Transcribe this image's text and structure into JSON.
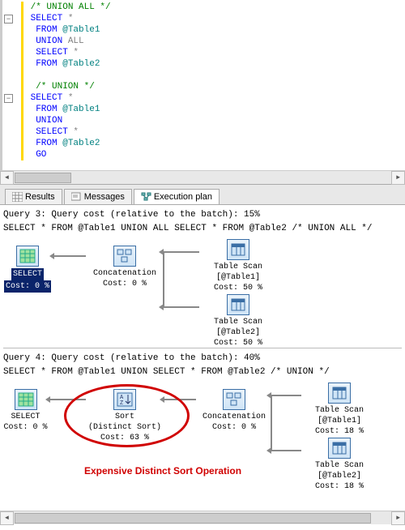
{
  "editor": {
    "lines": [
      {
        "fold": "",
        "yellow": true,
        "tokens": [
          {
            "t": "/* UNION ALL */",
            "c": "cmt"
          }
        ]
      },
      {
        "fold": "-",
        "yellow": true,
        "tokens": [
          {
            "t": "SELECT",
            "c": "kw"
          },
          {
            "t": " "
          },
          {
            "t": "*",
            "c": "star"
          }
        ]
      },
      {
        "fold": "",
        "yellow": true,
        "indent": 1,
        "tokens": [
          {
            "t": "FROM",
            "c": "kw"
          },
          {
            "t": " "
          },
          {
            "t": "@Table1",
            "c": "var"
          }
        ]
      },
      {
        "fold": "",
        "yellow": true,
        "indent": 1,
        "tokens": [
          {
            "t": "UNION",
            "c": "kw"
          },
          {
            "t": " "
          },
          {
            "t": "ALL",
            "c": "kwg"
          }
        ]
      },
      {
        "fold": "",
        "yellow": true,
        "indent": 1,
        "tokens": [
          {
            "t": "SELECT",
            "c": "kw"
          },
          {
            "t": " "
          },
          {
            "t": "*",
            "c": "star"
          }
        ]
      },
      {
        "fold": "",
        "yellow": true,
        "indent": 1,
        "tokens": [
          {
            "t": "FROM",
            "c": "kw"
          },
          {
            "t": " "
          },
          {
            "t": "@Table2",
            "c": "var"
          }
        ]
      },
      {
        "fold": "",
        "yellow": true,
        "tokens": [
          {
            "t": " "
          }
        ]
      },
      {
        "fold": "",
        "yellow": true,
        "indent": 1,
        "tokens": [
          {
            "t": "/* UNION */",
            "c": "cmt"
          }
        ]
      },
      {
        "fold": "-",
        "yellow": true,
        "tokens": [
          {
            "t": "SELECT",
            "c": "kw"
          },
          {
            "t": " "
          },
          {
            "t": "*",
            "c": "star"
          }
        ]
      },
      {
        "fold": "",
        "yellow": true,
        "indent": 1,
        "tokens": [
          {
            "t": "FROM",
            "c": "kw"
          },
          {
            "t": " "
          },
          {
            "t": "@Table1",
            "c": "var"
          }
        ]
      },
      {
        "fold": "",
        "yellow": true,
        "indent": 1,
        "tokens": [
          {
            "t": "UNION",
            "c": "kw"
          }
        ]
      },
      {
        "fold": "",
        "yellow": true,
        "indent": 1,
        "tokens": [
          {
            "t": "SELECT",
            "c": "kw"
          },
          {
            "t": " "
          },
          {
            "t": "*",
            "c": "star"
          }
        ]
      },
      {
        "fold": "",
        "yellow": true,
        "indent": 1,
        "tokens": [
          {
            "t": "FROM",
            "c": "kw"
          },
          {
            "t": " "
          },
          {
            "t": "@Table2",
            "c": "var"
          }
        ]
      },
      {
        "fold": "",
        "yellow": true,
        "indent": 1,
        "tokens": [
          {
            "t": "GO",
            "c": "kw"
          }
        ]
      }
    ]
  },
  "tabs": {
    "results": "Results",
    "messages": "Messages",
    "execplan": "Execution plan"
  },
  "query3": {
    "header1": "Query 3: Query cost (relative to the batch): 15%",
    "header2": "SELECT * FROM @Table1 UNION ALL SELECT * FROM @Table2 /* UNION ALL */",
    "select": {
      "label": "SELECT",
      "cost": "Cost: 0 %"
    },
    "concat": {
      "label": "Concatenation",
      "cost": "Cost: 0 %"
    },
    "ts1": {
      "label": "Table Scan",
      "obj": "[@Table1]",
      "cost": "Cost: 50 %"
    },
    "ts2": {
      "label": "Table Scan",
      "obj": "[@Table2]",
      "cost": "Cost: 50 %"
    }
  },
  "query4": {
    "header1": "Query 4: Query cost (relative to the batch): 40%",
    "header2": "SELECT * FROM @Table1 UNION SELECT * FROM @Table2 /* UNION */",
    "select": {
      "label": "SELECT",
      "cost": "Cost: 0 %"
    },
    "sort": {
      "label": "Sort",
      "sub": "(Distinct Sort)",
      "cost": "Cost: 63 %"
    },
    "concat": {
      "label": "Concatenation",
      "cost": "Cost: 0 %"
    },
    "ts1": {
      "label": "Table Scan",
      "obj": "[@Table1]",
      "cost": "Cost: 18 %"
    },
    "ts2": {
      "label": "Table Scan",
      "obj": "[@Table2]",
      "cost": "Cost: 18 %"
    },
    "annotation": "Expensive Distinct Sort Operation"
  }
}
